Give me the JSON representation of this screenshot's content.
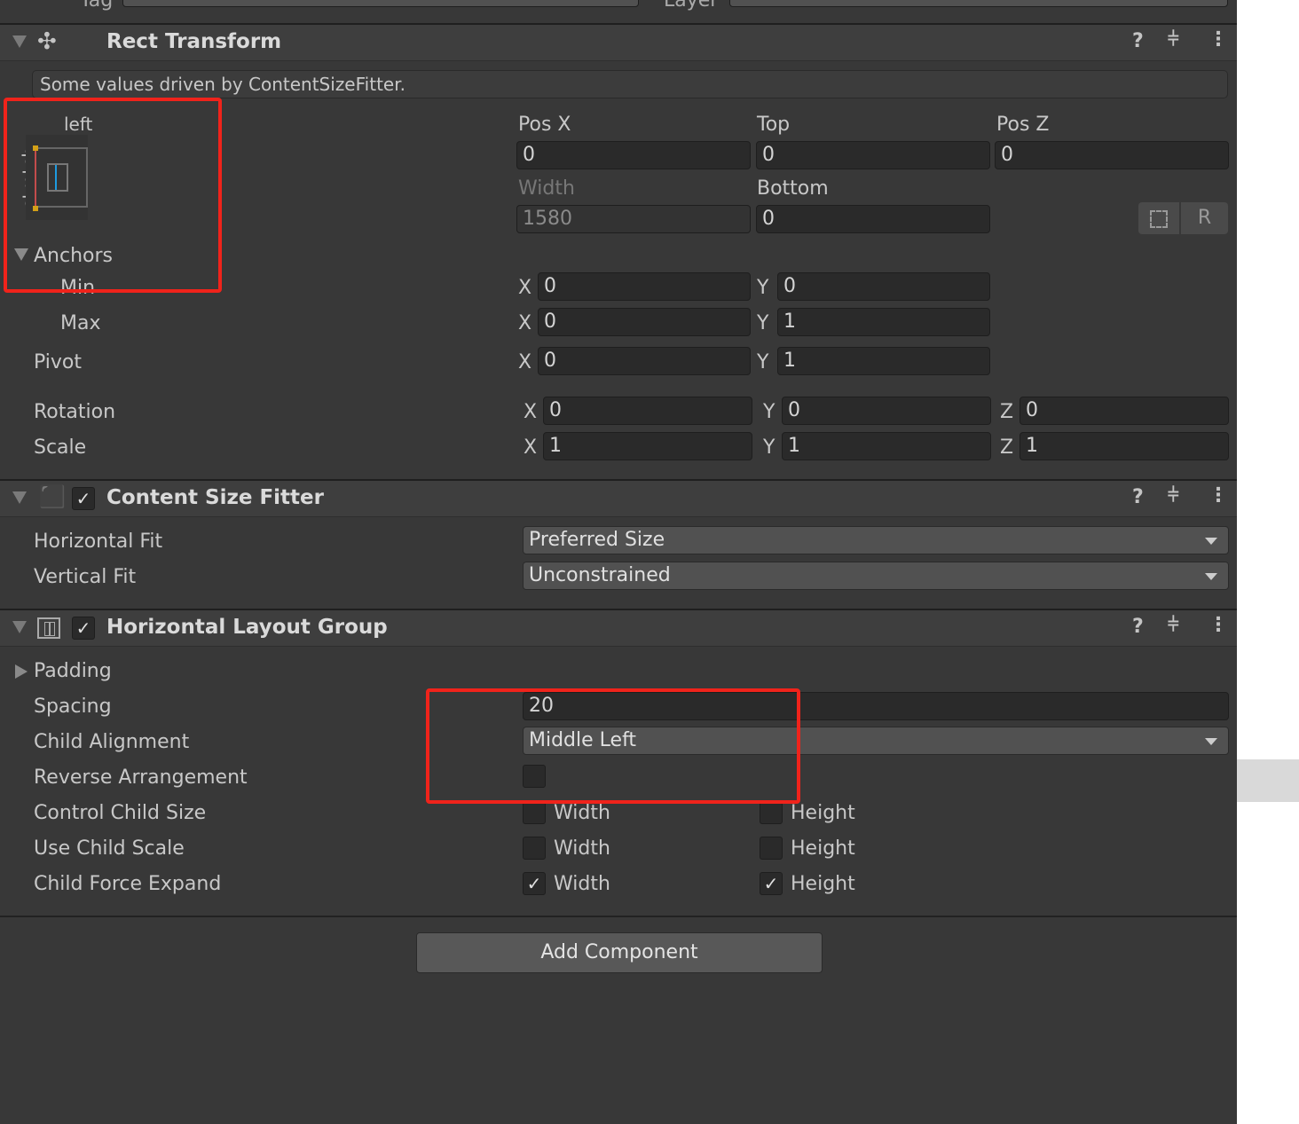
{
  "top": {
    "tag_label": "Tag",
    "layer_label": "Layer"
  },
  "rect_transform": {
    "title": "Rect Transform",
    "notice": "Some values driven by ContentSizeFitter.",
    "anchor_preset": {
      "horizontal": "left",
      "vertical": "stretch"
    },
    "labels": {
      "pos_x": "Pos X",
      "top": "Top",
      "pos_z": "Pos Z",
      "width": "Width",
      "bottom": "Bottom"
    },
    "values": {
      "pos_x": "0",
      "top": "0",
      "pos_z": "0",
      "width": "1580",
      "bottom": "0"
    },
    "blueprint_label": "R",
    "anchors": {
      "label": "Anchors",
      "min_label": "Min",
      "max_label": "Max",
      "min_x": "0",
      "min_y": "0",
      "max_x": "0",
      "max_y": "1"
    },
    "pivot": {
      "label": "Pivot",
      "x": "0",
      "y": "1"
    },
    "rotation": {
      "label": "Rotation",
      "x": "0",
      "y": "0",
      "z": "0"
    },
    "scale": {
      "label": "Scale",
      "x": "1",
      "y": "1",
      "z": "1"
    },
    "axis": {
      "x": "X",
      "y": "Y",
      "z": "Z"
    }
  },
  "content_size_fitter": {
    "title": "Content Size Fitter",
    "enabled": true,
    "horizontal_fit_label": "Horizontal Fit",
    "horizontal_fit": "Preferred Size",
    "vertical_fit_label": "Vertical Fit",
    "vertical_fit": "Unconstrained"
  },
  "horizontal_layout_group": {
    "title": "Horizontal Layout Group",
    "enabled": true,
    "padding_label": "Padding",
    "spacing_label": "Spacing",
    "spacing": "20",
    "child_alignment_label": "Child Alignment",
    "child_alignment": "Middle Left",
    "reverse_label": "Reverse Arrangement",
    "reverse": false,
    "control_child_size_label": "Control Child Size",
    "use_child_scale_label": "Use Child Scale",
    "child_force_expand_label": "Child Force Expand",
    "width_label": "Width",
    "height_label": "Height",
    "control_child_size": {
      "width": false,
      "height": false
    },
    "use_child_scale": {
      "width": false,
      "height": false
    },
    "child_force_expand": {
      "width": true,
      "height": true
    }
  },
  "add_component_label": "Add Component",
  "colors": {
    "panel": "#383838",
    "field": "#2a2a2a",
    "dropdown": "#515151",
    "highlight": "#f0231b",
    "anchor_blue": "#1e9be0"
  }
}
